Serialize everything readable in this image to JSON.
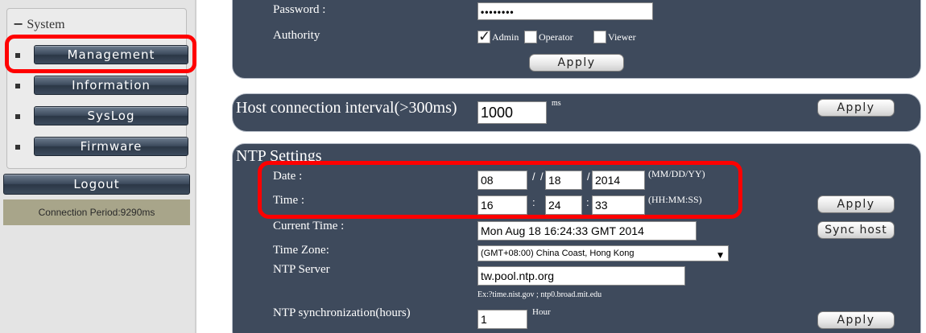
{
  "sidebar": {
    "section_title": "System",
    "items": [
      {
        "label": "Management"
      },
      {
        "label": "Information"
      },
      {
        "label": "SysLog"
      },
      {
        "label": "Firmware"
      }
    ],
    "logout_label": "Logout",
    "connection_period": "Connection Period:9290ms"
  },
  "account": {
    "password_label": "Password :",
    "password_value": "••••••••",
    "authority_label": "Authority",
    "roles": [
      {
        "label": "Admin",
        "checked": true
      },
      {
        "label": "Operator",
        "checked": false
      },
      {
        "label": "Viewer",
        "checked": false
      }
    ],
    "apply_label": "Apply"
  },
  "host": {
    "label": "Host connection interval(>300ms)",
    "value": "1000",
    "unit": "ms",
    "apply_label": "Apply"
  },
  "ntp": {
    "title": "NTP Settings",
    "date_label": "Date :",
    "date_month": "08",
    "date_day": "18",
    "date_year": "2014",
    "date_sep": "/",
    "date_format": "(MM/DD/YY)",
    "time_label": "Time :",
    "time_hour": "16",
    "time_min": "24",
    "time_sec": "33",
    "time_sep": ":",
    "time_format": "(HH:MM:SS)",
    "apply_label": "Apply",
    "current_time_label": "Current Time :",
    "current_time_value": "Mon Aug 18 16:24:33 GMT 2014",
    "sync_host_label": "Sync host",
    "timezone_label": "Time Zone:",
    "timezone_value": "(GMT+08:00) China Coast, Hong Kong",
    "server_label": "NTP Server",
    "server_value": "tw.pool.ntp.org",
    "server_hint": "Ex:?time.nist.gov ; ntp0.broad.mit.edu",
    "sync_label": "NTP synchronization(hours)",
    "sync_value": "1",
    "sync_unit": "Hour",
    "sync_apply_label": "Apply"
  },
  "colors": {
    "panel": "#3e4a5c",
    "highlight": "#ff0000",
    "sidebar": "#e4e4e4"
  }
}
